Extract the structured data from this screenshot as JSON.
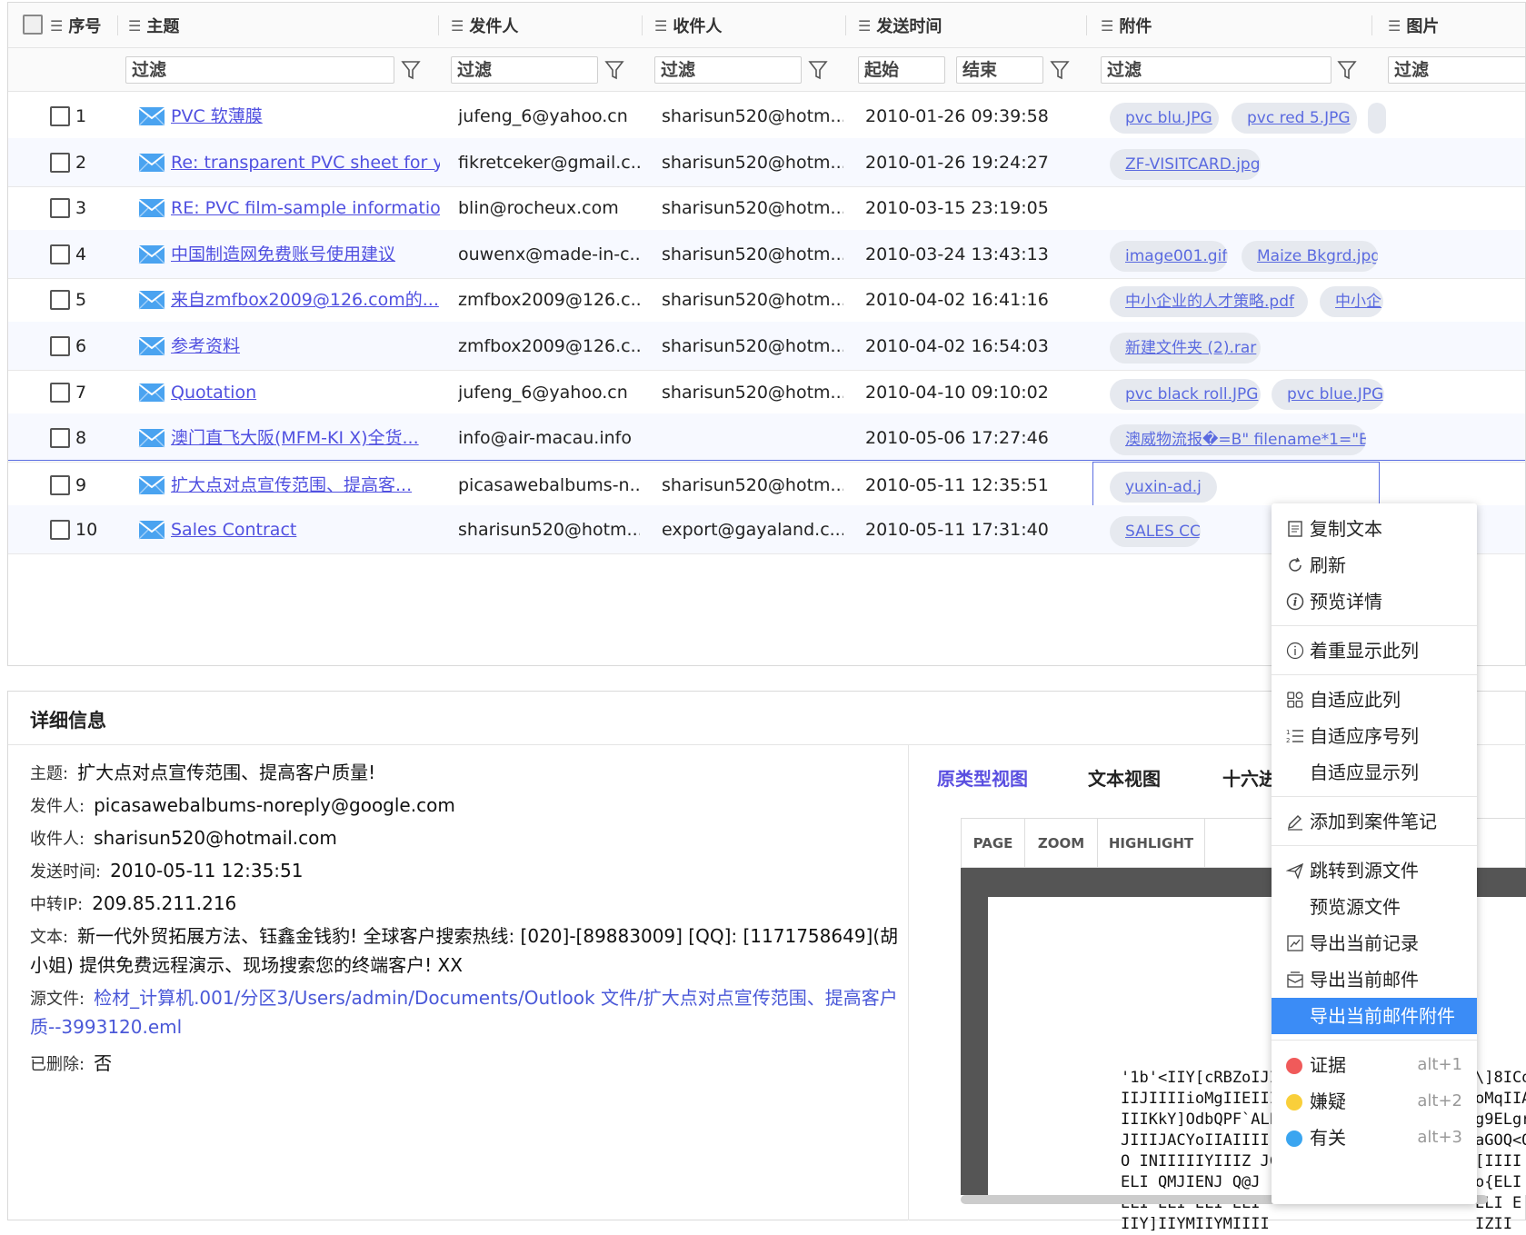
{
  "headers": {
    "seq": "序号",
    "subject": "主题",
    "from": "发件人",
    "to": "收件人",
    "time": "发送时间",
    "attach": "附件",
    "extra": "图片"
  },
  "filters": {
    "subject": "过滤",
    "from": "过滤",
    "to": "过滤",
    "time_start": "起始",
    "time_end": "结束",
    "attach": "过滤",
    "extra": "过滤"
  },
  "rows": [
    {
      "seq": "1",
      "subject": " PVC 软薄膜",
      "from": "jufeng_6@yahoo.cn",
      "to": "sharisun520@hotm...",
      "time": "2010-01-26 09:39:58",
      "tags": [
        "pvc blu.JPG",
        "pvc red 5.JPG"
      ]
    },
    {
      "seq": "2",
      "subject": "Re: transparent PVC sheet for y...",
      "from": "fikretceker@gmail.c...",
      "to": "sharisun520@hotm...",
      "time": "2010-01-26 19:24:27",
      "tags": [
        "ZF-VISITCARD.jpg"
      ]
    },
    {
      "seq": "3",
      "subject": "RE: PVC film-sample information",
      "from": "blin@rocheux.com",
      "to": "sharisun520@hotm...",
      "time": "2010-03-15 23:19:05",
      "tags": []
    },
    {
      "seq": "4",
      "subject": "中国制造网免费账号使用建议",
      "from": "ouwenx@made-in-c...",
      "to": "sharisun520@hotm...",
      "time": "2010-03-24 13:43:13",
      "tags": [
        "image001.gif",
        "Maize Bkgrd.jpg"
      ]
    },
    {
      "seq": "5",
      "subject": "来自zmfbox2009@126.com的...",
      "from": "zmfbox2009@126.c...",
      "to": "sharisun520@hotm...",
      "time": "2010-04-02 16:41:16",
      "tags": [
        "中小企业的人才策略.pdf",
        "中小企"
      ]
    },
    {
      "seq": "6",
      "subject": "参考资料",
      "from": "zmfbox2009@126.c...",
      "to": "sharisun520@hotm...",
      "time": "2010-04-02 16:54:03",
      "tags": [
        "新建文件夹 (2).rar"
      ]
    },
    {
      "seq": "7",
      "subject": "Quotation",
      "from": "jufeng_6@yahoo.cn",
      "to": "sharisun520@hotm...",
      "time": "2010-04-10 09:10:02",
      "tags": [
        "pvc black roll.JPG",
        "pvc blue.JPG"
      ]
    },
    {
      "seq": "8",
      "subject": "澳门直飞大阪(MFM-KI X)全货...",
      "from": "info@air-macau.info",
      "to": "",
      "time": "2010-05-06 17:27:46",
      "tags": [
        "澳威物流报�=B\" filename*1=\"B�.x"
      ]
    },
    {
      "seq": "9",
      "subject": "扩大点对点宣传范围、提高客...",
      "from": "picasawebalbums-n...",
      "to": "sharisun520@hotm...",
      "time": "2010-05-11 12:35:51",
      "tags": [
        "yuxin-ad.j"
      ]
    },
    {
      "seq": "10",
      "subject": "Sales Contract",
      "from": "sharisun520@hotm...",
      "to": "export@gayaland.c...",
      "time": "2010-05-11 17:31:40",
      "tags": [
        "SALES CC"
      ]
    }
  ],
  "detail": {
    "title": "详细信息",
    "subject_label": "主题:",
    "subject": "扩大点对点宣传范围、提高客户质量!",
    "from_label": "发件人:",
    "from": "picasawebalbums-noreply@google.com",
    "to_label": "收件人:",
    "to": "sharisun520@hotmail.com",
    "time_label": "发送时间:",
    "time": "2010-05-11 12:35:51",
    "ip_label": "中转IP:",
    "ip": "209.85.211.216",
    "text_label": "文本:",
    "text": "新一代外贸拓展方法、钰鑫金钱豹! 全球客户搜索热线: [020]-[89883009] [QQ]: [1171758649](胡小姐) 提供免费远程演示、现场搜索您的终端客户! XX",
    "src_label": "源文件:",
    "src": "检材_计算机.001/分区3/Users/admin/Documents/Outlook 文件/扩大点对点宣传范围、提高客户质--3993120.eml",
    "del_label": "已删除:",
    "del": "否"
  },
  "viewtabs": {
    "raw": "原类型视图",
    "text": "文本视图",
    "hex": "十六进"
  },
  "pdf": {
    "page": "PAGE",
    "zoom": "ZOOM",
    "highlight": "HIGHLIGHT",
    "lines_left": [
      "'1b'<IIY[cRBZoIJI",
      "IIJIIIIioMgIIEIII",
      "IIIKkY]OdbQPF`ALE",
      "JIIIJACYoIIAIIII`",
      "O INIIIIIYIIIZ JC",
      "ELI QMJIENJ Q@J",
      "ELI ELI ELI ELI",
      "IIY]IIYMIIYMIIII"
    ],
    "lines_right": [
      "\\]8ICo",
      "oMqIIA",
      "g9ELgr",
      "aGOQ<Q",
      "[IIII",
      "o{ELI",
      "ELI E",
      "IZII"
    ]
  },
  "menu": {
    "copy": "复制文本",
    "refresh": "刷新",
    "preview": "预览详情",
    "emphasize": "着重显示此列",
    "fit_col": "自适应此列",
    "fit_seq": "自适应序号列",
    "fit_show": "自适应显示列",
    "add_note": "添加到案件笔记",
    "jump": "跳转到源文件",
    "preview_src": "预览源文件",
    "export_record": "导出当前记录",
    "export_mail": "导出当前邮件",
    "export_attach": "导出当前邮件附件",
    "evidence": "证据",
    "evidence_key": "alt+1",
    "suspect": "嫌疑",
    "suspect_key": "alt+2",
    "related": "有关",
    "related_key": "alt+3"
  },
  "colors": {
    "accent": "#5b6ee1",
    "link": "#5050e0",
    "highlight": "#3b8cf6",
    "red": "#f05a5a",
    "yellow": "#f9cf3a",
    "blue": "#3aa5f0"
  }
}
